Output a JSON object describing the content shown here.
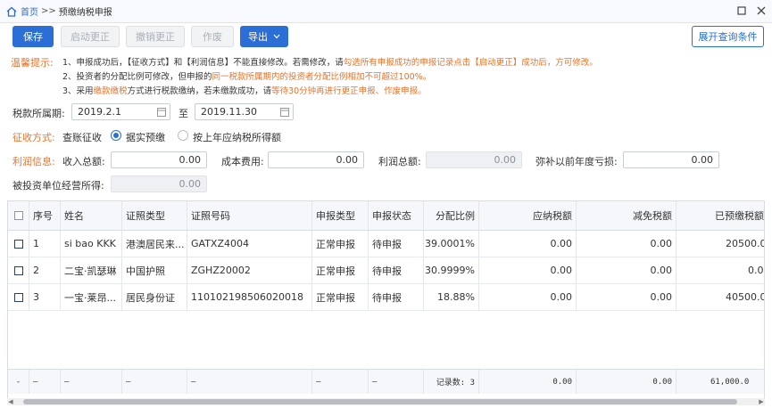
{
  "breadcrumb": {
    "home": "首页",
    "separator": ">>",
    "current": "预缴纳税申报"
  },
  "toolbar": {
    "save": "保存",
    "start_correction": "启动更正",
    "cancel_correction": "撤销更正",
    "void": "作废",
    "export": "导出",
    "expand_query": "展开查询条件"
  },
  "tips": {
    "label": "温馨提示:",
    "line1_a": "1、申报成功后，【征收方式】和【利润信息】不能直接修改。若需修改，请",
    "line1_b": "勾选所有申报成功的申报记录点击【启动更正】成功后，方可修改。",
    "line2_a": "2、投资者的分配比例可修改，但申报的",
    "line2_b": "同一税款所属期内的投资者分配比例相加不可超过100%。",
    "line3_a": "3、采用",
    "line3_b": "缴款缴税",
    "line3_c": "方式进行税款缴纳，若未缴款成功，请",
    "line3_d": "等待30分钟再进行更正申报、作废申报。"
  },
  "period": {
    "label": "税款所属期:",
    "from": "2019.2.1",
    "to_label": "至",
    "to": "2019.11.30"
  },
  "collection": {
    "label": "征收方式:",
    "sub_label": "查账征收",
    "option1": "据实预缴",
    "option2": "按上年应纳税所得额",
    "selected": "据实预缴"
  },
  "profit": {
    "label": "利润信息:",
    "income_label": "收入总额:",
    "income": "0.00",
    "cost_label": "成本费用:",
    "cost": "0.00",
    "total_label": "利润总额:",
    "total": "0.00",
    "loss_label": "弥补以前年度亏损:",
    "loss": "0.00",
    "invest_label": "被投资单位经营所得:",
    "invest": "0.00"
  },
  "table": {
    "headers": [
      "序号",
      "姓名",
      "证照类型",
      "证照号码",
      "申报类型",
      "申报状态",
      "分配比例",
      "应纳税额",
      "减免税额",
      "已预缴税额"
    ],
    "rows": [
      {
        "no": "1",
        "name": "si bao KKK",
        "id_type": "港澳居民来...",
        "id_no": "GATXZ4004",
        "decl_type": "正常申报",
        "status": "待申报",
        "ratio": "39.0001%",
        "tax": "0.00",
        "relief": "0.00",
        "prepaid": "20500.0"
      },
      {
        "no": "2",
        "name": "二宝·凯瑟琳",
        "id_type": "中国护照",
        "id_no": "ZGHZ20002",
        "decl_type": "正常申报",
        "status": "待申报",
        "ratio": "30.9999%",
        "tax": "0.00",
        "relief": "0.00",
        "prepaid": "0.0"
      },
      {
        "no": "3",
        "name": "一宝·莱昂...",
        "id_type": "居民身份证",
        "id_no": "110102198506020018",
        "decl_type": "正常申报",
        "status": "待申报",
        "ratio": "18.88%",
        "tax": "0.00",
        "relief": "0.00",
        "prepaid": "40500.0"
      }
    ],
    "footer": {
      "dash": "—",
      "count": "记录数: 3",
      "tax": "0.00",
      "relief": "0.00",
      "prepaid": "61,000.0"
    }
  },
  "colors": {
    "primary": "#2b6fd6",
    "accent": "#e8732a"
  }
}
